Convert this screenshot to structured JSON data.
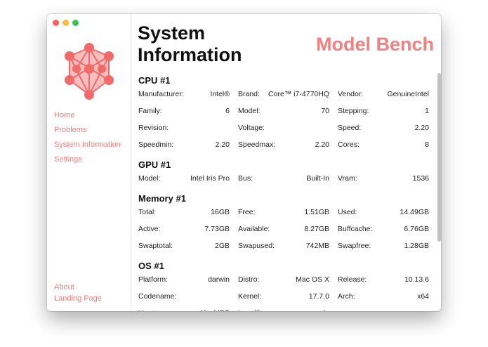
{
  "sidebar": {
    "nav": [
      "Home",
      "Problems",
      "System Information",
      "Settings"
    ],
    "bottom": [
      "About",
      "Landing Page"
    ]
  },
  "main": {
    "title_line1": "System",
    "title_line2": "Information",
    "brand": "Model Bench"
  },
  "colors": {
    "accent": "#f28282",
    "logo_node": "#f16a6a",
    "logo_fill": "#f7a7a7"
  },
  "sections": [
    {
      "title": "CPU  #1",
      "rows": [
        [
          [
            "Manufacturer:",
            "Intel®"
          ],
          [
            "Brand:",
            "Core™ i7-4770HQ"
          ],
          [
            "Vendor:",
            "GenuineIntel"
          ]
        ],
        [
          [
            "Family:",
            "6"
          ],
          [
            "Model:",
            "70"
          ],
          [
            "Stepping:",
            "1"
          ]
        ],
        [
          [
            "Revision:",
            ""
          ],
          [
            "Voltage:",
            ""
          ],
          [
            "Speed:",
            "2.20"
          ]
        ],
        [
          [
            "Speedmin:",
            "2.20"
          ],
          [
            "Speedmax:",
            "2.20"
          ],
          [
            "Cores:",
            "8"
          ]
        ]
      ]
    },
    {
      "title": "GPU  #1",
      "rows": [
        [
          [
            "Model:",
            "Intel Iris Pro"
          ],
          [
            "Bus:",
            "Built-In"
          ],
          [
            "Vram:",
            "1536"
          ]
        ]
      ]
    },
    {
      "title": "Memory  #1",
      "rows": [
        [
          [
            "Total:",
            "16GB"
          ],
          [
            "Free:",
            "1.51GB"
          ],
          [
            "Used:",
            "14.49GB"
          ]
        ],
        [
          [
            "Active:",
            "7.73GB"
          ],
          [
            "Available:",
            "8.27GB"
          ],
          [
            "Buffcache:",
            "6.76GB"
          ]
        ],
        [
          [
            "Swaptotal:",
            "2GB"
          ],
          [
            "Swapused:",
            "742MB"
          ],
          [
            "Swapfree:",
            "1.28GB"
          ]
        ]
      ]
    },
    {
      "title": "OS  #1",
      "rows": [
        [
          [
            "Platform:",
            "darwin"
          ],
          [
            "Distro:",
            "Mac OS X"
          ],
          [
            "Release:",
            "10.13.6"
          ]
        ],
        [
          [
            "Codename:",
            ""
          ],
          [
            "Kernel:",
            "17.7.0"
          ],
          [
            "Arch:",
            "x64"
          ]
        ],
        [
          [
            "Hostname:",
            "AlexMBP"
          ],
          [
            "Logofile:",
            "apple"
          ],
          [
            "",
            ""
          ]
        ]
      ]
    }
  ]
}
